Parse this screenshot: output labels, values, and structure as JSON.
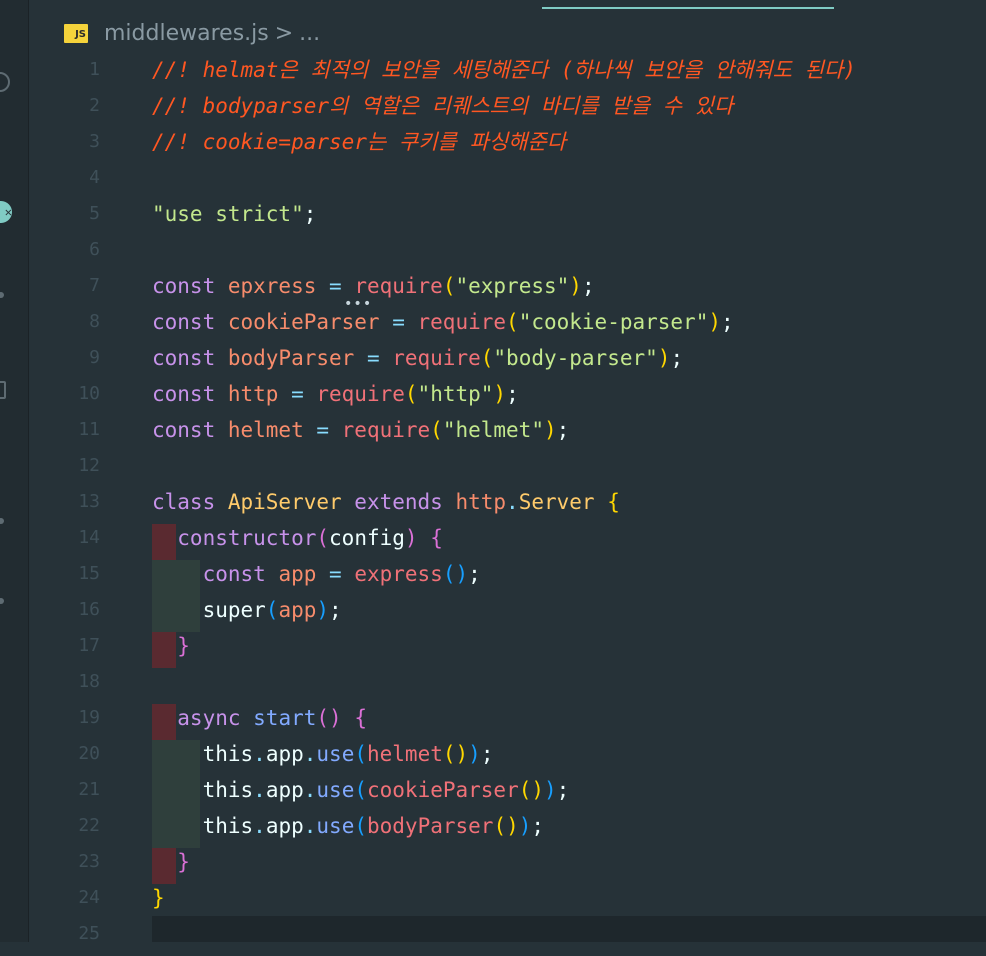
{
  "breadcrumb": {
    "file_icon_label": "JS",
    "file_name": "middlewares.js",
    "separator": ">",
    "ellipsis": "..."
  },
  "colors": {
    "background": "#263238",
    "comment": "#ff5722",
    "string": "#c3e88d",
    "keyword": "#c792ea",
    "accent": "#80cbc4"
  },
  "editor": {
    "lines": [
      {
        "num": "1",
        "tokens": [
          {
            "t": "//! helmat은 최적의 보안을 세팅해준다 (하나씩 보안을 안해줘도 된다)",
            "c": "c-cmt"
          }
        ]
      },
      {
        "num": "2",
        "tokens": [
          {
            "t": "//! bodyparser의 역할은 리퀘스트의 바디를 받을 수 있다",
            "c": "c-cmt"
          }
        ]
      },
      {
        "num": "3",
        "tokens": [
          {
            "t": "//! cookie=parser는 쿠키를 파싱해준다",
            "c": "c-cmt"
          }
        ]
      },
      {
        "num": "4",
        "tokens": []
      },
      {
        "num": "5",
        "tokens": [
          {
            "t": "\"use strict\"",
            "c": "c-str"
          },
          {
            "t": ";",
            "c": "c-plain"
          }
        ]
      },
      {
        "num": "6",
        "tokens": []
      },
      {
        "num": "7",
        "tokens": [
          {
            "t": "const ",
            "c": "c-kw"
          },
          {
            "t": "epxress",
            "c": "c-var"
          },
          {
            "t": " = ",
            "c": "c-punc"
          },
          {
            "t": "require",
            "c": "c-fn"
          },
          {
            "t": "(",
            "c": "c-paren1"
          },
          {
            "t": "\"express\"",
            "c": "c-str"
          },
          {
            "t": ")",
            "c": "c-paren1"
          },
          {
            "t": ";",
            "c": "c-plain"
          }
        ]
      },
      {
        "num": "8",
        "tokens": [
          {
            "t": "const ",
            "c": "c-kw"
          },
          {
            "t": "cookieParser",
            "c": "c-var"
          },
          {
            "t": " = ",
            "c": "c-punc"
          },
          {
            "t": "require",
            "c": "c-fn"
          },
          {
            "t": "(",
            "c": "c-paren1"
          },
          {
            "t": "\"cookie-parser\"",
            "c": "c-str"
          },
          {
            "t": ")",
            "c": "c-paren1"
          },
          {
            "t": ";",
            "c": "c-plain"
          }
        ]
      },
      {
        "num": "9",
        "tokens": [
          {
            "t": "const ",
            "c": "c-kw"
          },
          {
            "t": "bodyParser",
            "c": "c-var"
          },
          {
            "t": " = ",
            "c": "c-punc"
          },
          {
            "t": "require",
            "c": "c-fn"
          },
          {
            "t": "(",
            "c": "c-paren1"
          },
          {
            "t": "\"body-parser\"",
            "c": "c-str"
          },
          {
            "t": ")",
            "c": "c-paren1"
          },
          {
            "t": ";",
            "c": "c-plain"
          }
        ]
      },
      {
        "num": "10",
        "tokens": [
          {
            "t": "const ",
            "c": "c-kw"
          },
          {
            "t": "http",
            "c": "c-var"
          },
          {
            "t": " = ",
            "c": "c-punc"
          },
          {
            "t": "require",
            "c": "c-fn"
          },
          {
            "t": "(",
            "c": "c-paren1"
          },
          {
            "t": "\"http\"",
            "c": "c-str"
          },
          {
            "t": ")",
            "c": "c-paren1"
          },
          {
            "t": ";",
            "c": "c-plain"
          }
        ]
      },
      {
        "num": "11",
        "tokens": [
          {
            "t": "const ",
            "c": "c-kw"
          },
          {
            "t": "helmet",
            "c": "c-var"
          },
          {
            "t": " = ",
            "c": "c-punc"
          },
          {
            "t": "require",
            "c": "c-fn"
          },
          {
            "t": "(",
            "c": "c-paren1"
          },
          {
            "t": "\"helmet\"",
            "c": "c-str"
          },
          {
            "t": ")",
            "c": "c-paren1"
          },
          {
            "t": ";",
            "c": "c-plain"
          }
        ]
      },
      {
        "num": "12",
        "tokens": []
      },
      {
        "num": "13",
        "tokens": [
          {
            "t": "class ",
            "c": "c-kw"
          },
          {
            "t": "ApiServer",
            "c": "c-class"
          },
          {
            "t": " extends ",
            "c": "c-kw"
          },
          {
            "t": "http",
            "c": "c-var"
          },
          {
            "t": ".",
            "c": "c-punc"
          },
          {
            "t": "Server",
            "c": "c-class"
          },
          {
            "t": " {",
            "c": "c-paren1"
          }
        ]
      },
      {
        "num": "14",
        "indent": "red",
        "tokens": [
          {
            "t": "  constructor",
            "c": "c-kw"
          },
          {
            "t": "(",
            "c": "c-paren2"
          },
          {
            "t": "config",
            "c": "c-plain"
          },
          {
            "t": ")",
            "c": "c-paren2"
          },
          {
            "t": " {",
            "c": "c-paren2"
          }
        ]
      },
      {
        "num": "15",
        "indent": "green",
        "tokens": [
          {
            "t": "    const ",
            "c": "c-kw"
          },
          {
            "t": "app",
            "c": "c-var"
          },
          {
            "t": " = ",
            "c": "c-punc"
          },
          {
            "t": "express",
            "c": "c-fn"
          },
          {
            "t": "()",
            "c": "c-paren3"
          },
          {
            "t": ";",
            "c": "c-plain"
          }
        ]
      },
      {
        "num": "16",
        "indent": "green",
        "tokens": [
          {
            "t": "    super",
            "c": "c-plain"
          },
          {
            "t": "(",
            "c": "c-paren3"
          },
          {
            "t": "app",
            "c": "c-var"
          },
          {
            "t": ")",
            "c": "c-paren3"
          },
          {
            "t": ";",
            "c": "c-plain"
          }
        ]
      },
      {
        "num": "17",
        "indent": "red",
        "tokens": [
          {
            "t": "  }",
            "c": "c-paren2"
          }
        ]
      },
      {
        "num": "18",
        "tokens": []
      },
      {
        "num": "19",
        "indent": "red",
        "tokens": [
          {
            "t": "  async ",
            "c": "c-kw"
          },
          {
            "t": "start",
            "c": "c-method"
          },
          {
            "t": "()",
            "c": "c-paren2"
          },
          {
            "t": " {",
            "c": "c-paren2"
          }
        ]
      },
      {
        "num": "20",
        "indent": "green",
        "tokens": [
          {
            "t": "    this",
            "c": "c-plain"
          },
          {
            "t": ".",
            "c": "c-punc"
          },
          {
            "t": "app",
            "c": "c-plain"
          },
          {
            "t": ".",
            "c": "c-punc"
          },
          {
            "t": "use",
            "c": "c-method"
          },
          {
            "t": "(",
            "c": "c-paren3"
          },
          {
            "t": "helmet",
            "c": "c-fn"
          },
          {
            "t": "()",
            "c": "c-paren1"
          },
          {
            "t": ")",
            "c": "c-paren3"
          },
          {
            "t": ";",
            "c": "c-plain"
          }
        ]
      },
      {
        "num": "21",
        "indent": "green",
        "tokens": [
          {
            "t": "    this",
            "c": "c-plain"
          },
          {
            "t": ".",
            "c": "c-punc"
          },
          {
            "t": "app",
            "c": "c-plain"
          },
          {
            "t": ".",
            "c": "c-punc"
          },
          {
            "t": "use",
            "c": "c-method"
          },
          {
            "t": "(",
            "c": "c-paren3"
          },
          {
            "t": "cookieParser",
            "c": "c-fn"
          },
          {
            "t": "()",
            "c": "c-paren1"
          },
          {
            "t": ")",
            "c": "c-paren3"
          },
          {
            "t": ";",
            "c": "c-plain"
          }
        ]
      },
      {
        "num": "22",
        "indent": "green",
        "tokens": [
          {
            "t": "    this",
            "c": "c-plain"
          },
          {
            "t": ".",
            "c": "c-punc"
          },
          {
            "t": "app",
            "c": "c-plain"
          },
          {
            "t": ".",
            "c": "c-punc"
          },
          {
            "t": "use",
            "c": "c-method"
          },
          {
            "t": "(",
            "c": "c-paren3"
          },
          {
            "t": "bodyParser",
            "c": "c-fn"
          },
          {
            "t": "()",
            "c": "c-paren1"
          },
          {
            "t": ")",
            "c": "c-paren3"
          },
          {
            "t": ";",
            "c": "c-plain"
          }
        ]
      },
      {
        "num": "23",
        "indent": "red",
        "tokens": [
          {
            "t": "  }",
            "c": "c-paren2"
          }
        ]
      },
      {
        "num": "24",
        "tokens": [
          {
            "t": "}",
            "c": "c-paren1"
          }
        ]
      },
      {
        "num": "25",
        "tokens": []
      }
    ]
  }
}
